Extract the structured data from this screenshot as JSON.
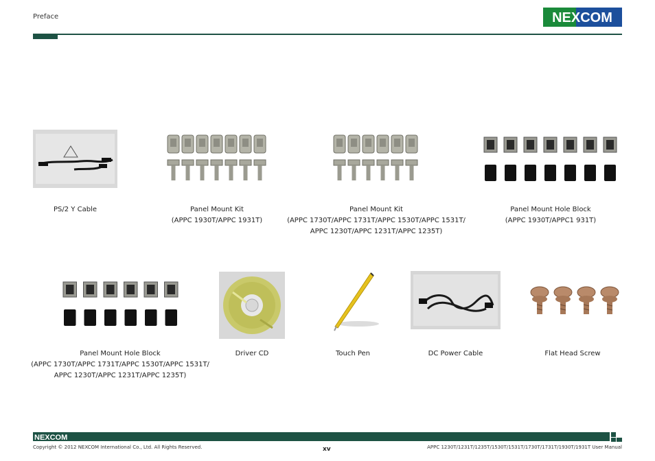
{
  "header": {
    "section": "Preface",
    "logo_text": "NEXCOM"
  },
  "items": [
    {
      "label": "PS/2 Y Cable",
      "note": ""
    },
    {
      "label": "Panel Mount Kit",
      "note": "(APPC 1930T/APPC 1931T)"
    },
    {
      "label": "Panel Mount Kit",
      "note_1": "(APPC 1730T/APPC 1731T/APPC 1530T/APPC 1531T/",
      "note_2": "APPC 1230T/APPC 1231T/APPC 1235T)"
    },
    {
      "label": "Panel Mount Hole Block",
      "note": "(APPC 1930T/APPC1 931T)"
    },
    {
      "label": "Panel Mount Hole Block",
      "note_1": "(APPC 1730T/APPC 1731T/APPC 1530T/APPC 1531T/",
      "note_2": "APPC 1230T/APPC 1231T/APPC 1235T)"
    },
    {
      "label": "Driver CD"
    },
    {
      "label": "Touch Pen"
    },
    {
      "label": "DC Power Cable"
    },
    {
      "label": "Flat Head Screw"
    }
  ],
  "footer": {
    "logo_text": "NEXCOM",
    "copyright": "Copyright © 2012 NEXCOM International Co., Ltd. All Rights Reserved.",
    "page_number": "xv",
    "manual_title": "APPC 1230T/1231T/1235T/1530T/1531T/1730T/1731T/1930T/1931T User Manual"
  },
  "colors": {
    "brand_green": "#1d5244",
    "logo_green": "#1a8a3a",
    "logo_blue": "#1c4f9c"
  }
}
